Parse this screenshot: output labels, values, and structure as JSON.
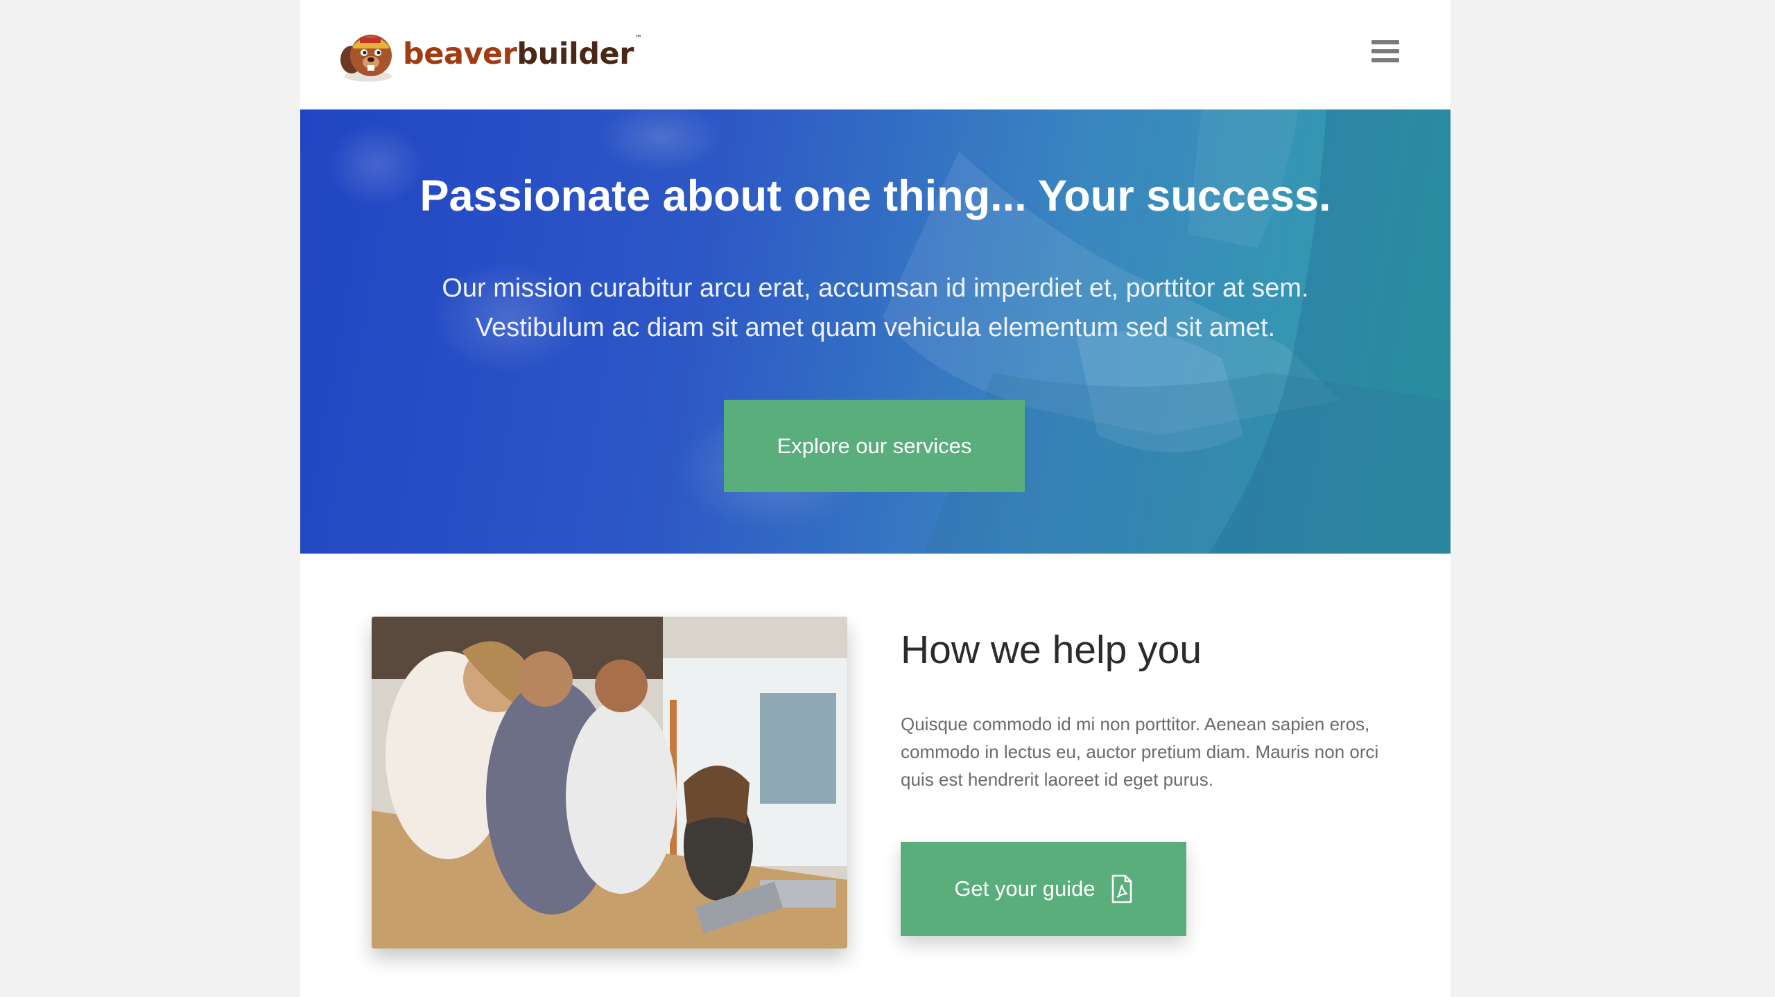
{
  "header": {
    "logo": {
      "part1": "beaver",
      "part2": "builder",
      "tm": "™"
    },
    "menu_icon": "hamburger-menu-icon"
  },
  "hero": {
    "title": "Passionate about one thing... Your success.",
    "text_line1": "Our mission curabitur arcu erat, accumsan id imperdiet et, porttitor at sem.",
    "text_line2": "Vestibulum ac diam sit amet quam vehicula elementum sed sit amet.",
    "button_label": "Explore our services"
  },
  "help": {
    "title": "How we help you",
    "body": "Quisque commodo id mi non porttitor. Aenean sapien eros, commodo in lectus eu, auctor pretium diam. Mauris non orci quis est hendrerit laoreet id eget purus.",
    "button_label": "Get your guide",
    "button_icon": "file-pdf-icon"
  },
  "colors": {
    "accent_green": "#5aae7c",
    "hero_blue": "#2145c4",
    "hero_teal": "#31a4a6",
    "logo_brown": "#a23a12"
  }
}
